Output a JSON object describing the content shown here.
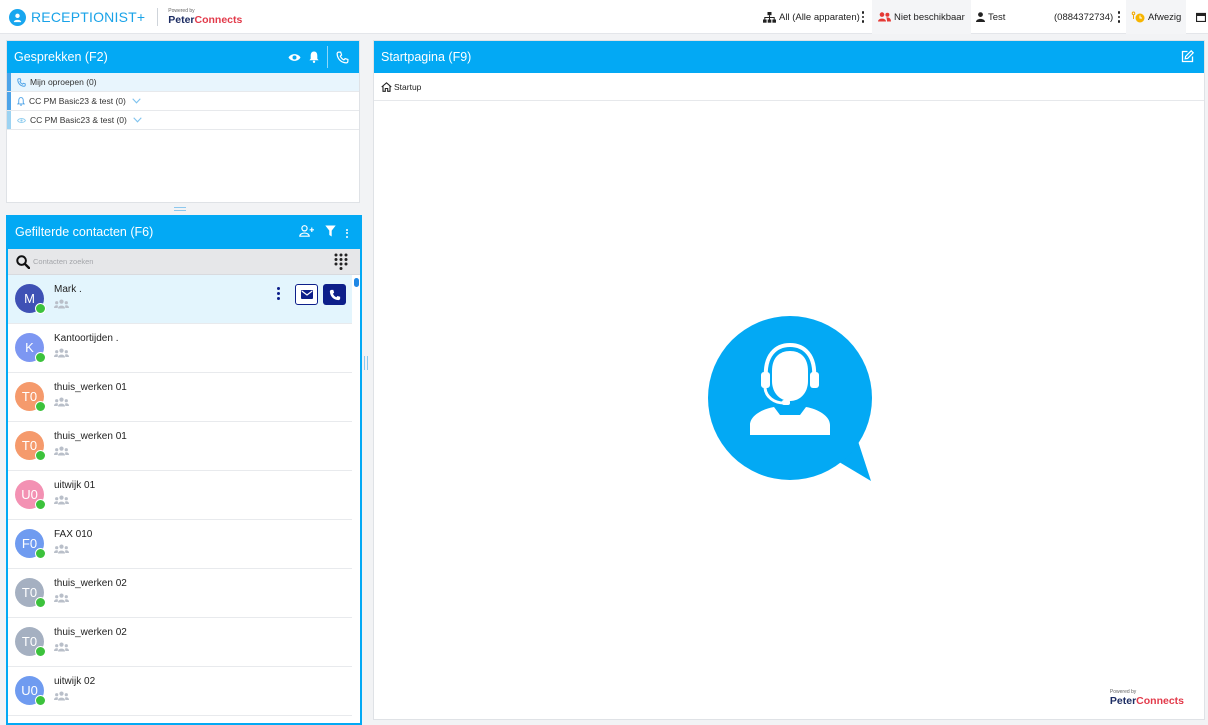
{
  "app": {
    "name": "RECEPTIONIST+",
    "powered_by": "Powered by",
    "vendor_part1": "Peter",
    "vendor_part2": "Connects"
  },
  "topbar": {
    "devices": "All (Alle apparaten)",
    "availability": "Niet beschikbaar",
    "user": "Test",
    "phone": "(0884372734)",
    "presence": "Afwezig"
  },
  "gesprekken": {
    "title": "Gesprekken (F2)",
    "rows": [
      {
        "label": "Mijn oproepen (0)",
        "icon": "phone-icon",
        "bar_color": "#4da3e8"
      },
      {
        "label": "CC PM Basic23 & test (0)",
        "icon": "bell-icon",
        "bar_color": "#4da3e8"
      },
      {
        "label": "CC PM Basic23 & test (0)",
        "icon": "eye-icon",
        "bar_color": "#9dd3f2"
      }
    ]
  },
  "contacts": {
    "title": "Gefilterde contacten  (F6)",
    "search_placeholder": "Contacten zoeken",
    "items": [
      {
        "initials": "M",
        "name": "Mark .",
        "color": "#3f51b5"
      },
      {
        "initials": "K",
        "name": "Kantoortijden .",
        "color": "#7d97f2"
      },
      {
        "initials": "T0",
        "name": "thuis_werken 01",
        "color": "#f59a6c"
      },
      {
        "initials": "T0",
        "name": "thuis_werken 01",
        "color": "#f59a6c"
      },
      {
        "initials": "U0",
        "name": "uitwijk 01",
        "color": "#f391b3"
      },
      {
        "initials": "F0",
        "name": "FAX 010",
        "color": "#6f9bf0"
      },
      {
        "initials": "T0",
        "name": "thuis_werken 02",
        "color": "#a5b0c1"
      },
      {
        "initials": "T0",
        "name": "thuis_werken 02",
        "color": "#a5b0c1"
      },
      {
        "initials": "U0",
        "name": "uitwijk 02",
        "color": "#6f9bf0"
      }
    ]
  },
  "startpagina": {
    "title": "Startpagina (F9)",
    "breadcrumb": "Startup"
  },
  "colors": {
    "accent": "#03a9f4",
    "online": "#3cc23c",
    "dark_button": "#0d1f8a"
  }
}
